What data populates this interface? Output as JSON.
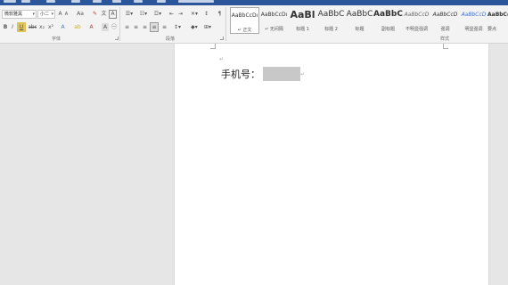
{
  "ribbon": {
    "font_name": "微软雅黑",
    "font_size": "小二",
    "groups": {
      "font": "字体",
      "paragraph": "段落",
      "styles": "样式"
    },
    "styles": [
      {
        "sample": "AaBbCcDı",
        "name": "↵ 正文",
        "selected": true
      },
      {
        "sample": "AaBbCcDı",
        "name": "↵ 无间隔"
      },
      {
        "sample": "AaBl",
        "name": "标题 1"
      },
      {
        "sample": "AaBbC",
        "name": "标题 2"
      },
      {
        "sample": "AaBbC",
        "name": "标题"
      },
      {
        "sample": "AaBbC",
        "name": "副标题"
      },
      {
        "sample": "AaBbCcD",
        "name": "不明显强调"
      },
      {
        "sample": "AaBbCcD",
        "name": "强调"
      },
      {
        "sample": "AaBbCcD",
        "name": "明显强调"
      },
      {
        "sample": "AaBbCcD",
        "name": "要点"
      }
    ]
  },
  "document": {
    "label": "手机号：",
    "para_mark": "↵"
  }
}
